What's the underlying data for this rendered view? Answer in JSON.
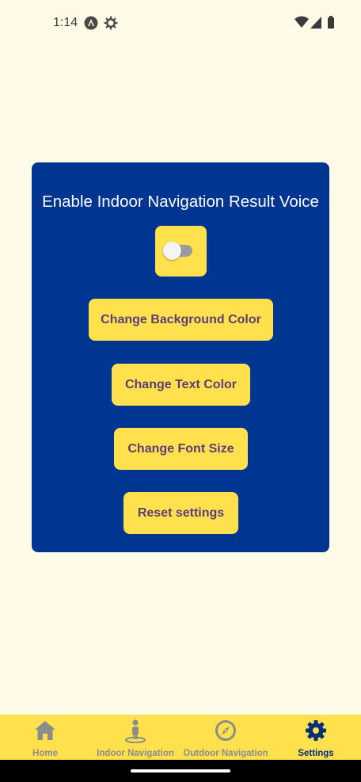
{
  "status_bar": {
    "time": "1:14",
    "icons": [
      "app-notification-icon",
      "settings-gear-icon",
      "wifi-icon",
      "cell-signal-icon",
      "battery-icon"
    ]
  },
  "settings": {
    "voice_label": "Enable Indoor Navigation Result Voice",
    "voice_toggle_on": false,
    "buttons": {
      "change_background": "Change Background Color",
      "change_text_color": "Change Text Color",
      "change_font_size": "Change Font Size",
      "reset": "Reset settings"
    }
  },
  "tabs": [
    {
      "label": "Home",
      "icon": "home-icon",
      "active": false
    },
    {
      "label": "Indoor Navigation",
      "icon": "person-location-icon",
      "active": false
    },
    {
      "label": "Outdoor Navigation",
      "icon": "compass-icon",
      "active": false
    },
    {
      "label": "Settings",
      "icon": "gear-icon",
      "active": true
    }
  ],
  "colors": {
    "background": "#FFFBE6",
    "card": "#003591",
    "accent_yellow": "#FFE14D",
    "button_text": "#5a3e7a",
    "tab_inactive": "#8c8c8c",
    "tab_active": "#002e7a"
  }
}
